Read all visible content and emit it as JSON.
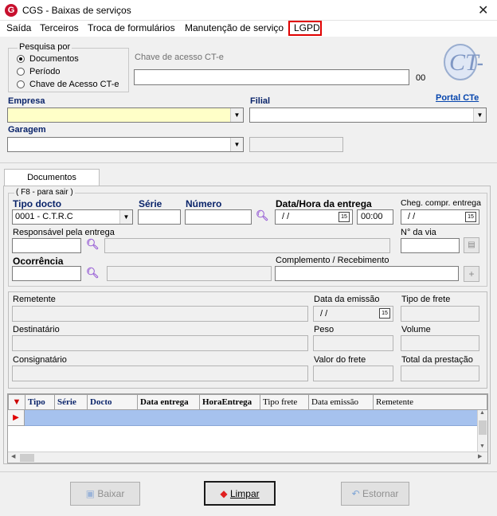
{
  "window": {
    "title": "CGS - Baixas de serviços",
    "close_icon": "close-icon",
    "app_icon_letter": "G"
  },
  "menu": {
    "items": [
      "Saída",
      "Terceiros",
      "Troca de formulários",
      "Manutenção de serviço",
      "LGPD"
    ]
  },
  "search": {
    "group_title": "Pesquisa por",
    "options": [
      "Documentos",
      "Período",
      "Chave de Acesso CT-e"
    ],
    "selected": "Documentos",
    "key_label": "Chave de acesso CT-e",
    "key_suffix": "00",
    "logo_text": "CT-e"
  },
  "fields": {
    "empresa_label": "Empresa",
    "filial_label": "Filial",
    "portal_link": "Portal CTe",
    "garagem_label": "Garagem"
  },
  "tabs": [
    "Documentos"
  ],
  "docs": {
    "group_title": "( F8 - para sair )",
    "tipo_docto_label": "Tipo docto",
    "tipo_docto_value": "0001 - C.T.R.C",
    "serie_label": "Série",
    "numero_label": "Número",
    "data_hora_label": "Data/Hora da entrega",
    "data_value": "/ /",
    "hora_value": "00:00",
    "cheg_label": "Cheg. compr. entrega",
    "cheg_value": "/ /",
    "responsavel_label": "Responsável pela entrega",
    "via_label": "N° da via",
    "ocorrencia_label": "Ocorrência",
    "complemento_label": "Complemento / Recebimento"
  },
  "info": {
    "remetente_label": "Remetente",
    "data_emissao_label": "Data da emissão",
    "data_emissao_value": "/ /",
    "tipo_frete_label": "Tipo de frete",
    "destinatario_label": "Destinatário",
    "peso_label": "Peso",
    "volume_label": "Volume",
    "consignatario_label": "Consignatário",
    "valor_frete_label": "Valor do frete",
    "total_prestacao_label": "Total da prestação"
  },
  "grid": {
    "columns": [
      "Tipo",
      "Série",
      "Docto",
      "Data entrega",
      "HoraEntrega",
      "Tipo frete",
      "Data emissão",
      "Remetente"
    ]
  },
  "buttons": {
    "baixar": "Baixar",
    "limpar": "Limpar",
    "estornar": "Estornar"
  },
  "colors": {
    "accent": "#c8102e",
    "highlight": "#e00000",
    "row_select": "#a6c2ee",
    "link": "#0645ad"
  }
}
